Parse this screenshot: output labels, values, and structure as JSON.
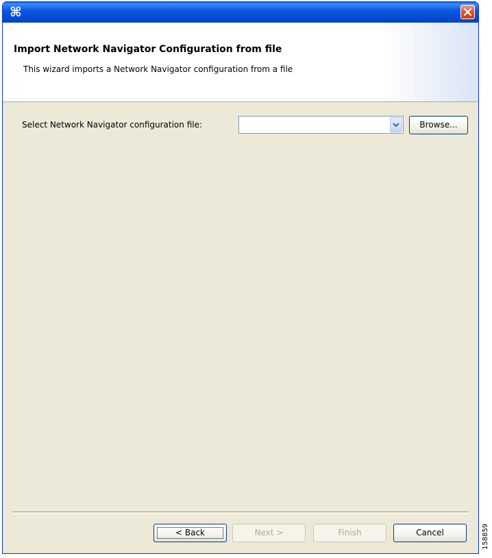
{
  "window": {
    "icon": "network-navigator-app-icon"
  },
  "header": {
    "title": "Import Network Navigator Configuration from file",
    "description": "This wizard imports a Network Navigator configuration from a file"
  },
  "form": {
    "file_label": "Select Network Navigator configuration file:",
    "file_value": "",
    "browse_label": "Browse..."
  },
  "buttons": {
    "back": "< Back",
    "next": "Next >",
    "finish": "Finish",
    "cancel": "Cancel"
  },
  "figure_id": "158859",
  "colors": {
    "titlebar": "#0c59e0",
    "dialog_bg": "#ece9d8",
    "close": "#e3572f"
  }
}
